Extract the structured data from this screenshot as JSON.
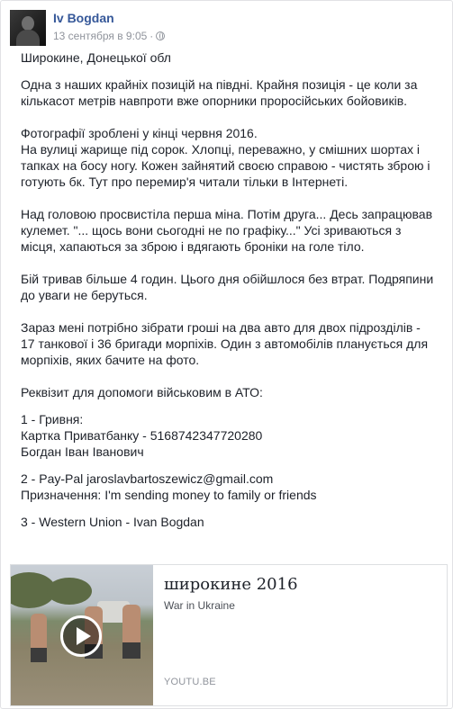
{
  "post": {
    "author": "Iv Bogdan",
    "date": "13 сентября в 9:05",
    "separator": "·",
    "privacy_icon": "globe-icon",
    "paragraphs": [
      "Широкине, Донецької обл",
      "Одна з наших крайніх позицій на півдні. Крайня позиція - це коли за кількасот метрів навпроти вже опорники проросійських бойовиків.",
      "Фотографії зроблені у кінці червня 2016.\nНа вулиці жарище під сорок. Хлопці, переважно, у смішних шортах і тапках на босу ногу. Кожен зайнятий своєю справою - чистять зброю і готують бк. Тут про перемир'я читали тільки в Інтернеті.",
      "Над головою просвистіла перша міна. Потім друга... Десь запрацював кулемет. \"... щось вони сьогодні не по графіку...\" Усі зриваються з місця, хапаються за зброю і вдягають броніки на голе тіло.",
      "Бій тривав більше 4 годин. Цього дня обійшлося без втрат. Подряпини до уваги не беруться.",
      "Зараз мені потрібно зібрати гроші на два авто для двох підрозділів - 17 танкової і 36 бригади морпіхів. Один з автомобілів планується для морпіхів, яких бачите на фото.",
      "Реквізит для допомоги військовим в АТО:",
      "1 - Гривня:\nКартка Приватбанку - 5168742347720280\nБогдан Іван Іванович",
      "2 - Pay-Pal jaroslavbartoszewicz@gmail.com\nПризначення: I'm sending money to family or friends",
      "3 - Western Union - Ivan Bogdan"
    ]
  },
  "link_card": {
    "title": "широкине 2016",
    "subtitle": "War in Ukraine",
    "domain": "YOUTU.BE",
    "play_icon": "play-icon"
  }
}
